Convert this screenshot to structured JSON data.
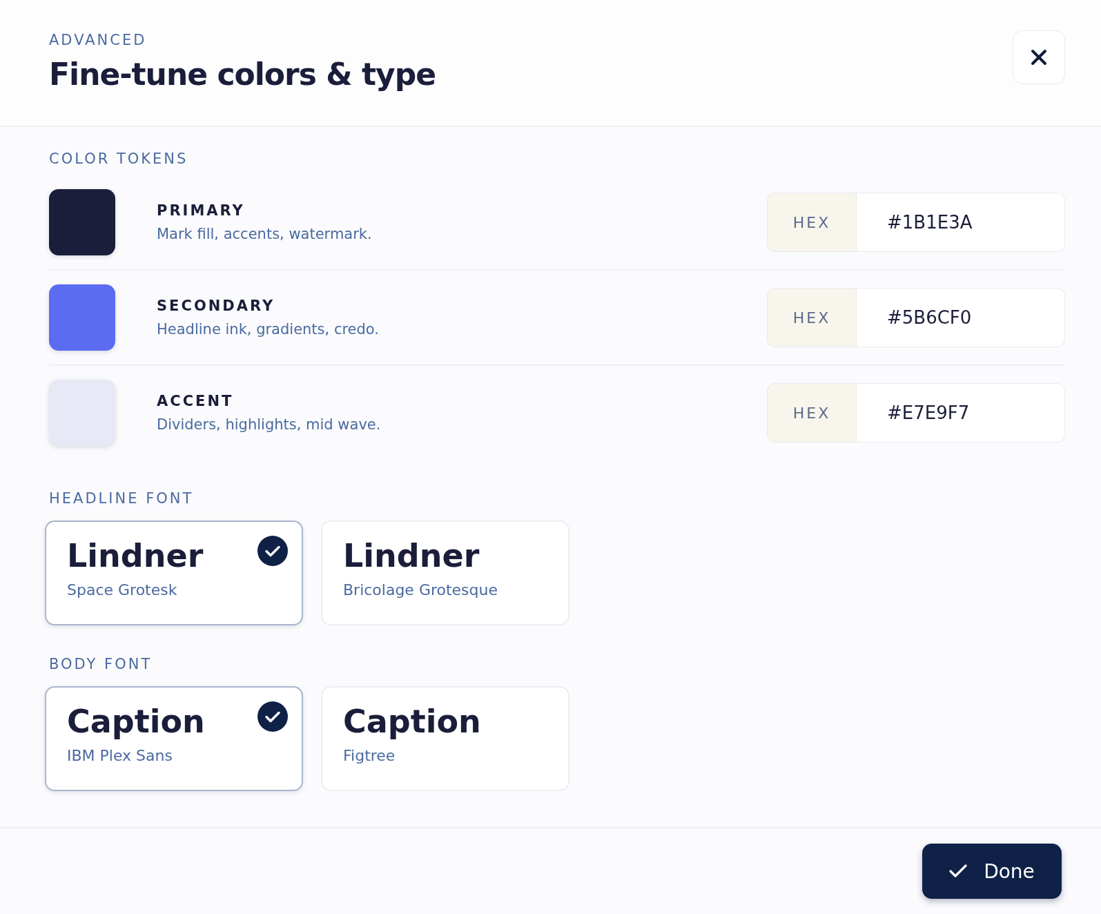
{
  "header": {
    "eyebrow": "ADVANCED",
    "title": "Fine-tune colors & type"
  },
  "color_tokens": {
    "heading": "COLOR TOKENS",
    "items": [
      {
        "label": "PRIMARY",
        "description": "Mark fill, accents, watermark.",
        "color": "#1b1e3a",
        "prefix": "HEX",
        "value": "#1B1E3A"
      },
      {
        "label": "SECONDARY",
        "description": "Headline ink, gradients, credo.",
        "color": "#5b6cf0",
        "prefix": "HEX",
        "value": "#5B6CF0"
      },
      {
        "label": "ACCENT",
        "description": "Dividers, highlights, mid wave.",
        "color": "#e7e9f7",
        "prefix": "HEX",
        "value": "#E7E9F7"
      }
    ]
  },
  "headline_font": {
    "heading": "HEADLINE FONT",
    "options": [
      {
        "sample": "Lindner",
        "name": "Space Grotesk",
        "selected": true
      },
      {
        "sample": "Lindner",
        "name": "Bricolage Grotesque",
        "selected": false
      }
    ]
  },
  "body_font": {
    "heading": "BODY FONT",
    "options": [
      {
        "sample": "Caption",
        "name": "IBM Plex Sans",
        "selected": true
      },
      {
        "sample": "Caption",
        "name": "Figtree",
        "selected": false
      }
    ]
  },
  "footer": {
    "button": "Done"
  }
}
